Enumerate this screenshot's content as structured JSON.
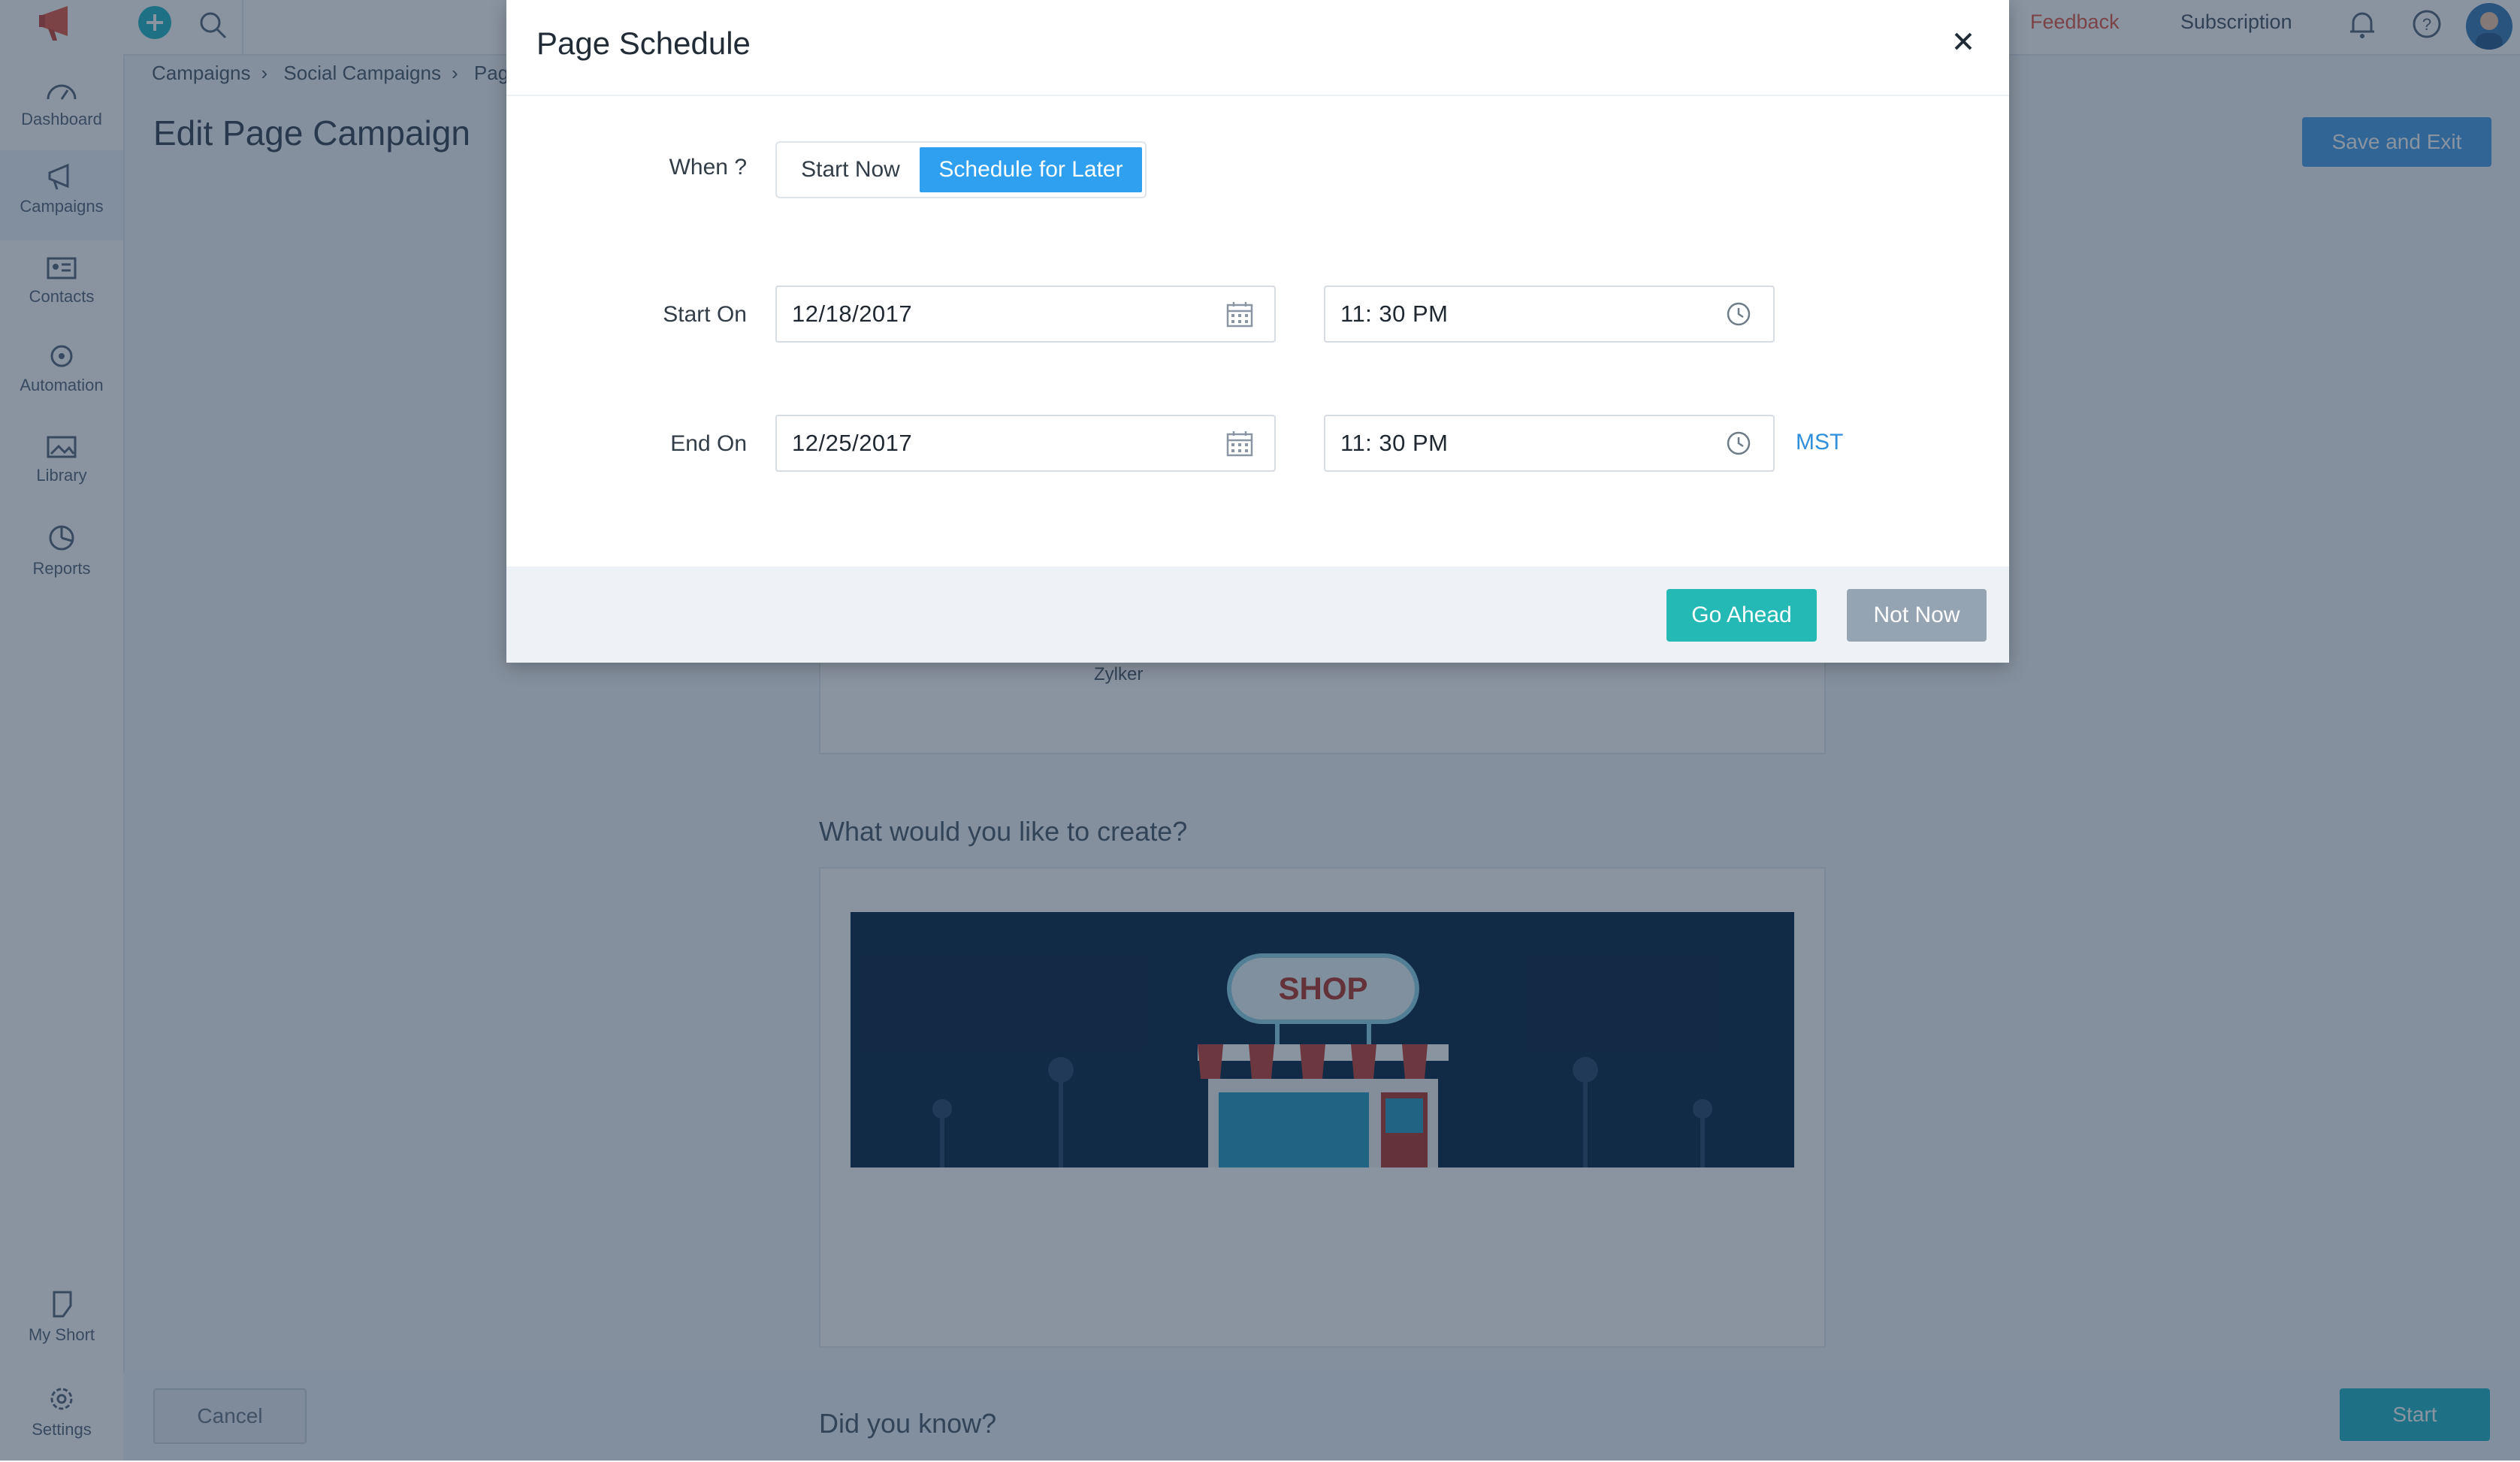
{
  "app": {
    "top_links": {
      "feedback": "Feedback",
      "subscription": "Subscription"
    },
    "sidebar": {
      "items": [
        {
          "label": "Dashboard",
          "icon": "dashboard-icon"
        },
        {
          "label": "Campaigns",
          "icon": "megaphone-icon"
        },
        {
          "label": "Contacts",
          "icon": "contact-card-icon"
        },
        {
          "label": "Automation",
          "icon": "automation-icon"
        },
        {
          "label": "Library",
          "icon": "image-icon"
        },
        {
          "label": "Reports",
          "icon": "pie-chart-icon"
        }
      ],
      "bottom": [
        {
          "label": "My Short",
          "icon": "shortcut-icon"
        },
        {
          "label": "Settings",
          "icon": "gear-icon"
        }
      ]
    },
    "breadcrumb": [
      "Campaigns",
      "Social Campaigns",
      "Pag"
    ],
    "page_title": "Edit Page Campaign",
    "save_exit": "Save and Exit",
    "brand_name": "Zylker",
    "create_title": "What would you like to create?",
    "shop_sign": "SHOP",
    "know_title": "Did you know?",
    "cancel": "Cancel",
    "start": "Start"
  },
  "modal": {
    "title": "Page Schedule",
    "when_label": "When ?",
    "options": {
      "now": "Start Now",
      "later": "Schedule for Later",
      "selected": "later"
    },
    "start_label": "Start On",
    "start_date": "12/18/2017",
    "start_time": "11: 30  PM",
    "end_label": "End On",
    "end_date": "12/25/2017",
    "end_time": "11: 30  PM",
    "timezone": "MST",
    "go_ahead": "Go Ahead",
    "not_now": "Not Now"
  },
  "colors": {
    "accent": "#2f9ff0",
    "primary_button": "#25b9b6",
    "secondary_button": "#95a4b3",
    "overlay": "rgba(22,42,68,0.50)",
    "feedback_text": "#e35c4b"
  }
}
